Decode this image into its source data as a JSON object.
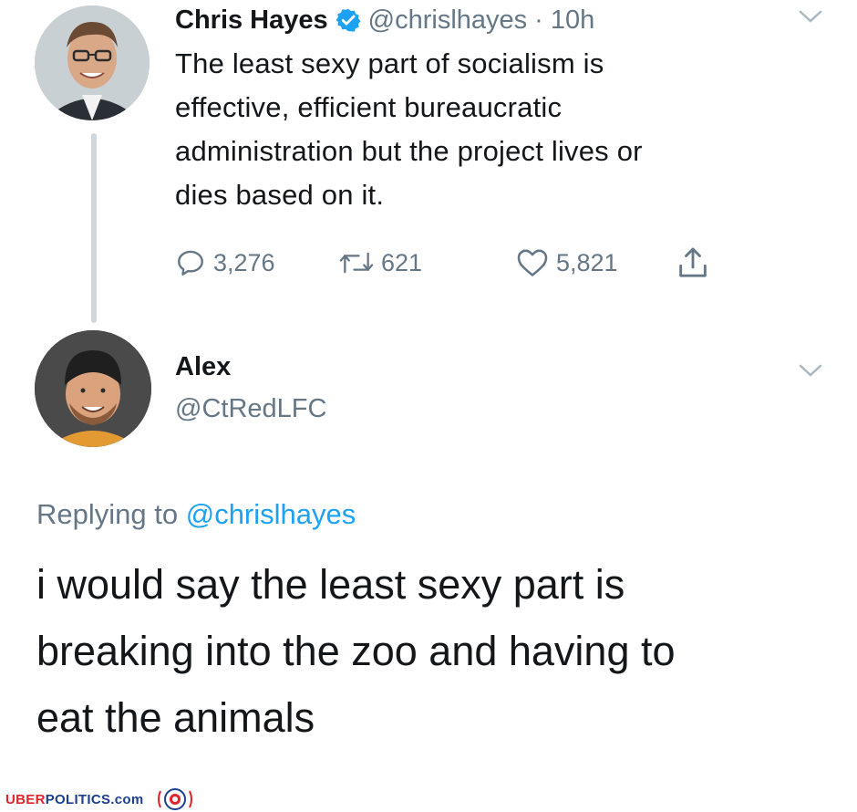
{
  "tweet": {
    "author_name": "Chris Hayes",
    "handle": "@chrislhayes",
    "separator": "·",
    "time": "10h",
    "verified_icon": "verified-badge-icon",
    "text_lines": [
      "The least sexy part of socialism is",
      "effective, efficient bureaucratic",
      "administration but the project lives or",
      "dies based on it."
    ],
    "actions": {
      "replies": "3,276",
      "retweets": "621",
      "likes": "5,821"
    }
  },
  "reply": {
    "author_name": "Alex",
    "handle": "@CtRedLFC",
    "replying_prefix": "Replying to",
    "replying_to": "@chrislhayes",
    "text_lines": [
      "i would say the least sexy part is",
      "breaking into the zoo and having to",
      "eat the animals"
    ]
  },
  "footer": {
    "brand_a": "UBER",
    "brand_b": "POLITICS",
    "brand_c": ".com"
  },
  "colors": {
    "accent": "#1da1f2",
    "muted": "#657786",
    "brand_red": "#e0242b",
    "brand_blue": "#1d3f8f"
  }
}
